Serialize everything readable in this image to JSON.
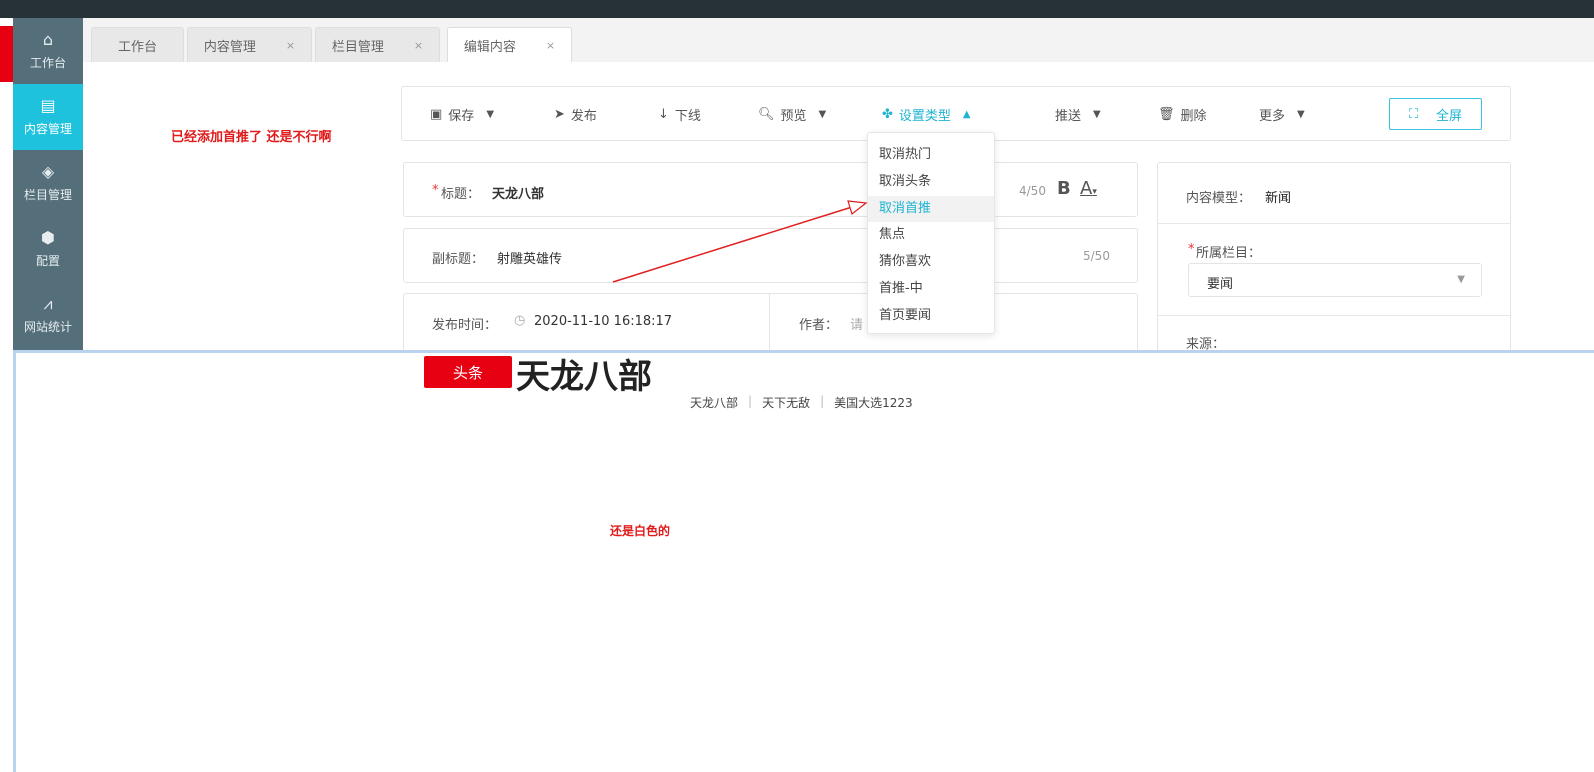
{
  "sidebar": {
    "items": [
      {
        "label": "工作台",
        "icon": "home-icon"
      },
      {
        "label": "内容管理",
        "icon": "document-icon"
      },
      {
        "label": "栏目管理",
        "icon": "layers-icon"
      },
      {
        "label": "配置",
        "icon": "cube-icon"
      },
      {
        "label": "网站统计",
        "icon": "chart-icon"
      }
    ]
  },
  "tabs": [
    {
      "label": "工作台"
    },
    {
      "label": "内容管理"
    },
    {
      "label": "栏目管理"
    },
    {
      "label": "编辑内容"
    }
  ],
  "tab_close": "×",
  "toolbar": {
    "save": "保存",
    "publish": "发布",
    "offline": "下线",
    "preview": "预览",
    "set_type": "设置类型",
    "push": "推送",
    "delete": "删除",
    "more": "更多",
    "fullscreen": "全屏"
  },
  "dropdown": {
    "items": [
      "取消热门",
      "取消头条",
      "取消首推",
      "焦点",
      "猜你喜欢",
      "首推-中",
      "首页要闻"
    ]
  },
  "form": {
    "title_label": "标题：",
    "title_value": "天龙八部",
    "title_count": "4/50",
    "subtitle_label": "副标题：",
    "subtitle_value": "射雕英雄传",
    "subtitle_count": "5/50",
    "time_label": "发布时间：",
    "time_value": "2020-11-10 16:18:17",
    "author_label": "作者：",
    "author_placeholder": "请",
    "required": "*"
  },
  "right": {
    "model_label": "内容模型：",
    "model_value": "新闻",
    "column_label": "所属栏目：",
    "column_value": "要闻",
    "source_label": "来源："
  },
  "notes": {
    "top": "已经添加首推了  还是不行啊",
    "bottom": "还是白色的"
  },
  "preview": {
    "badge": "头条",
    "title": "天龙八部",
    "tags": [
      "天龙八部",
      "天下无敌",
      "美国大选1223"
    ]
  },
  "colors": {
    "accent": "#1fc2dc",
    "red": "#e60012",
    "sidebar": "#546e7a"
  }
}
